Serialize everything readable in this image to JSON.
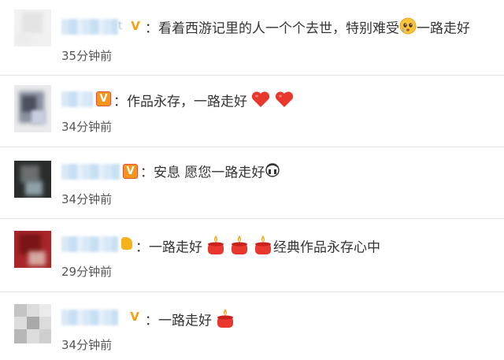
{
  "comments": [
    {
      "name_tail": "t",
      "badge": "V",
      "separator": "：",
      "text": "看着西游记里的人一个个去世，特别难受",
      "text_after": "一路走好",
      "time": "35分钟前"
    },
    {
      "name_tail": "",
      "badge": "V",
      "separator": "：",
      "text": "作品永存，一路走好",
      "time": "34分钟前"
    },
    {
      "name_tail": "",
      "badge": "V",
      "separator": "：",
      "text": "安息 愿您一路走好",
      "time": "34分钟前"
    },
    {
      "name_tail": "",
      "badge": "",
      "separator": "：",
      "text": "一路走好",
      "text_after": "经典作品永存心中",
      "time": "29分钟前"
    },
    {
      "name_tail": "",
      "badge": "V",
      "separator": "：",
      "text": "一路走好",
      "time": "34分钟前"
    }
  ],
  "icons": {
    "badge_v": "verified-v-icon",
    "heart": "red-heart-icon",
    "candle": "candle-icon",
    "crying": "crying-face-icon",
    "sad": "sad-face-icon"
  },
  "colors": {
    "text": "#333333",
    "time": "#555555",
    "divider": "#e3e3e3",
    "badge": "#f7a10e",
    "heart": "#e8372d",
    "candle": "#e8372d"
  }
}
